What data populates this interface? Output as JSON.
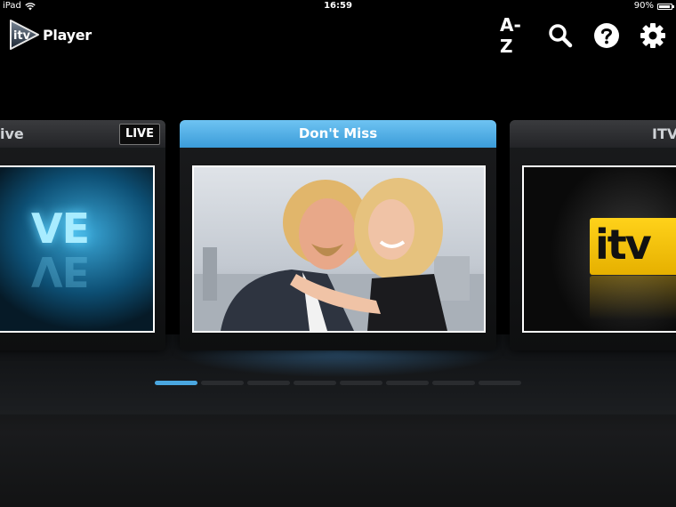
{
  "status_bar": {
    "device": "iPad",
    "time": "16:59",
    "battery": "90%",
    "battery_level": 0.9
  },
  "header": {
    "logo_badge_text": "itv",
    "logo_text": "Player",
    "az_label": "A-Z",
    "icons": [
      "search-icon",
      "help-icon",
      "gear-icon"
    ]
  },
  "carousel": {
    "left_card": {
      "title": "ive",
      "badge": "LIVE",
      "thumb_text": "VE"
    },
    "center_card": {
      "title": "Don't Miss"
    },
    "right_card": {
      "title": "ITV",
      "thumb_text": "itv"
    },
    "page_count": 8,
    "active_page": 1
  },
  "colors": {
    "accent": "#4aa7e0",
    "header_blue": "#3b9cd9",
    "itv_yellow": "#f5c400"
  }
}
